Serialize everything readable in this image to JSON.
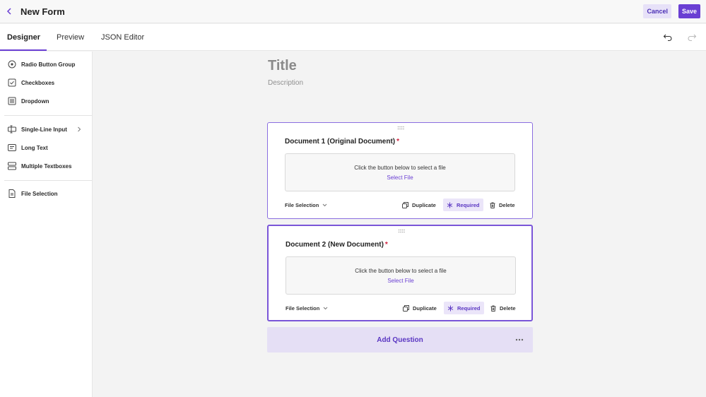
{
  "header": {
    "title": "New Form",
    "cancel_label": "Cancel",
    "save_label": "Save"
  },
  "tabs": [
    {
      "label": "Designer",
      "active": true
    },
    {
      "label": "Preview",
      "active": false
    },
    {
      "label": "JSON Editor",
      "active": false
    }
  ],
  "toolbar": {
    "undo_icon": "undo-icon",
    "redo_icon": "redo-icon"
  },
  "sidebar": {
    "items": [
      {
        "label": "Radio Button Group",
        "icon": "radio-icon"
      },
      {
        "label": "Checkboxes",
        "icon": "checkbox-icon"
      },
      {
        "label": "Dropdown",
        "icon": "dropdown-list-icon"
      },
      {
        "label": "Single-Line Input",
        "icon": "text-cursor-icon"
      },
      {
        "label": "Long Text",
        "icon": "long-text-icon"
      },
      {
        "label": "Multiple Textboxes",
        "icon": "multiple-textboxes-icon"
      },
      {
        "label": "File Selection",
        "icon": "file-icon"
      }
    ]
  },
  "form": {
    "title": "Title",
    "description": "Description",
    "questions": [
      {
        "title": "Document 1 (Original Document)",
        "required_mark": "*",
        "drop_text": "Click the button below to select a file",
        "select_label": "Select File",
        "type_label": "File Selection",
        "duplicate_label": "Duplicate",
        "required_label": "Required",
        "delete_label": "Delete"
      },
      {
        "title": "Document 2 (New Document)",
        "required_mark": "*",
        "drop_text": "Click the button below to select a file",
        "select_label": "Select File",
        "type_label": "File Selection",
        "duplicate_label": "Duplicate",
        "required_label": "Required",
        "delete_label": "Delete"
      }
    ],
    "add_question_label": "Add Question"
  },
  "colors": {
    "accent": "#6a3fd3",
    "accent_light": "#e5dff5",
    "required_star": "#d0213f"
  }
}
